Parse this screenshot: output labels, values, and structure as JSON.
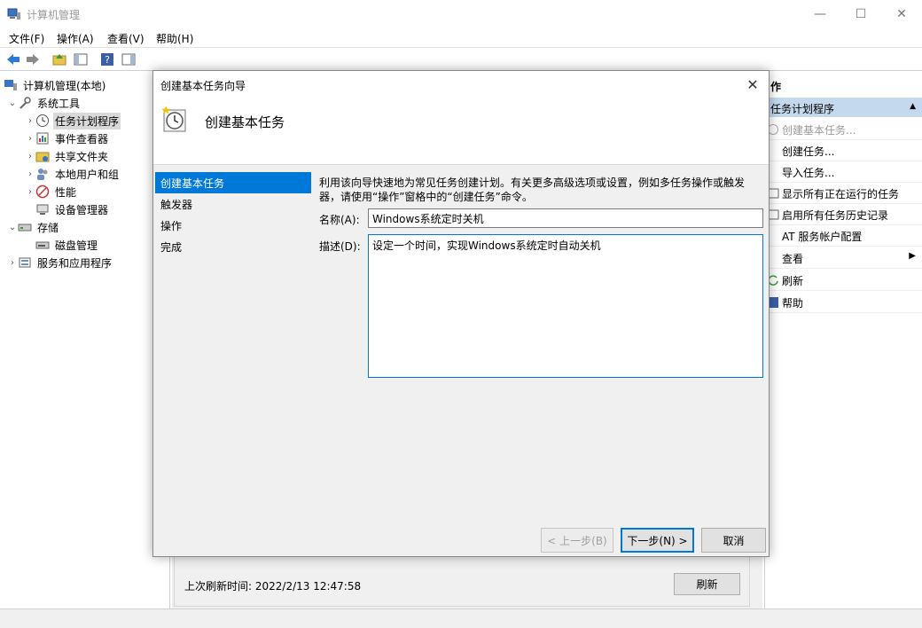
{
  "window": {
    "title": "计算机管理"
  },
  "menu": [
    "文件(F)",
    "操作(A)",
    "查看(V)",
    "帮助(H)"
  ],
  "tree": {
    "root": "计算机管理(本地)",
    "system_tools": "系统工具",
    "task_scheduler": "任务计划程序",
    "event_viewer": "事件查看器",
    "shared_folders": "共享文件夹",
    "local_users": "本地用户和组",
    "performance": "性能",
    "device_manager": "设备管理器",
    "storage": "存储",
    "disk_management": "磁盘管理",
    "services_apps": "服务和应用程序"
  },
  "actions": {
    "header": "作",
    "section": "任务计划程序",
    "items": [
      "创建基本任务...",
      "创建任务...",
      "导入任务...",
      "显示所有正在运行的任务",
      "启用所有任务历史记录",
      "AT 服务帐户配置",
      "查看",
      "刷新",
      "帮助"
    ]
  },
  "background": {
    "last_refresh": "上次刷新时间: 2022/2/13 12:47:58",
    "refresh_button": "刷新"
  },
  "dialog": {
    "title": "创建基本任务向导",
    "header_title": "创建基本任务",
    "steps": [
      "创建基本任务",
      "触发器",
      "操作",
      "完成"
    ],
    "description": "利用该向导快速地为常见任务创建计划。有关更多高级选项或设置，例如多任务操作或触发器，请使用“操作”窗格中的“创建任务”命令。",
    "name_label": "名称(A):",
    "name_value": "Windows系统定时关机",
    "desc_label": "描述(D):",
    "desc_value": "设定一个时间，实现Windows系统定时自动关机",
    "back_button": "< 上一步(B)",
    "next_button": "下一步(N) >",
    "cancel_button": "取消"
  },
  "colors": {
    "accent": "#0078d7",
    "action_section": "#c4d9ee"
  }
}
